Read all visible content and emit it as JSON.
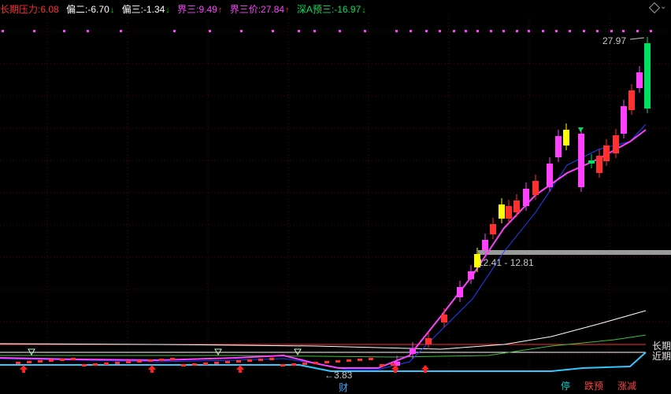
{
  "header": {
    "items": [
      {
        "label": "长期压力:",
        "value": "6.08",
        "color": "#ff3030",
        "arrow": ""
      },
      {
        "label": "偏二:",
        "value": "-6.70",
        "color": "#ffffff",
        "arrow": "↓",
        "arrow_color": "#00e000"
      },
      {
        "label": "偏三:",
        "value": "-1.34",
        "color": "#ffffff",
        "arrow": "↓",
        "arrow_color": "#00e000"
      },
      {
        "label": "界三:",
        "value": "9.49",
        "color": "#ff40ff",
        "arrow": "↑",
        "arrow_color": "#ff3030"
      },
      {
        "label": "界三价:",
        "value": "27.84",
        "color": "#ff40ff",
        "arrow": "↑",
        "arrow_color": "#ff3030"
      },
      {
        "label": "深A预三:",
        "value": "-16.97",
        "color": "#00e060",
        "arrow": "↓",
        "arrow_color": "#00e000"
      }
    ]
  },
  "labels": {
    "price_top": "27.97",
    "price_low": "3.83",
    "range": "12.41 - 12.81",
    "cai": "财",
    "legend_long": "长期",
    "legend_near": "近期"
  },
  "buttons": [
    {
      "label": "停",
      "color": "#00d0d0"
    },
    {
      "label": "跌预",
      "color": "#ff4040"
    },
    {
      "label": "涨减",
      "color": "#ff4040"
    }
  ],
  "icons": [
    "diamond-icon",
    "up-arrow-icon",
    "down-arrow-icon"
  ],
  "colors": {
    "bg": "#000000",
    "grid": "#7a0000",
    "up": "#ff3030",
    "down": "#00e060",
    "magenta": "#ff00ff",
    "yellow": "#ffff00",
    "cyan": "#00c8ff"
  }
}
